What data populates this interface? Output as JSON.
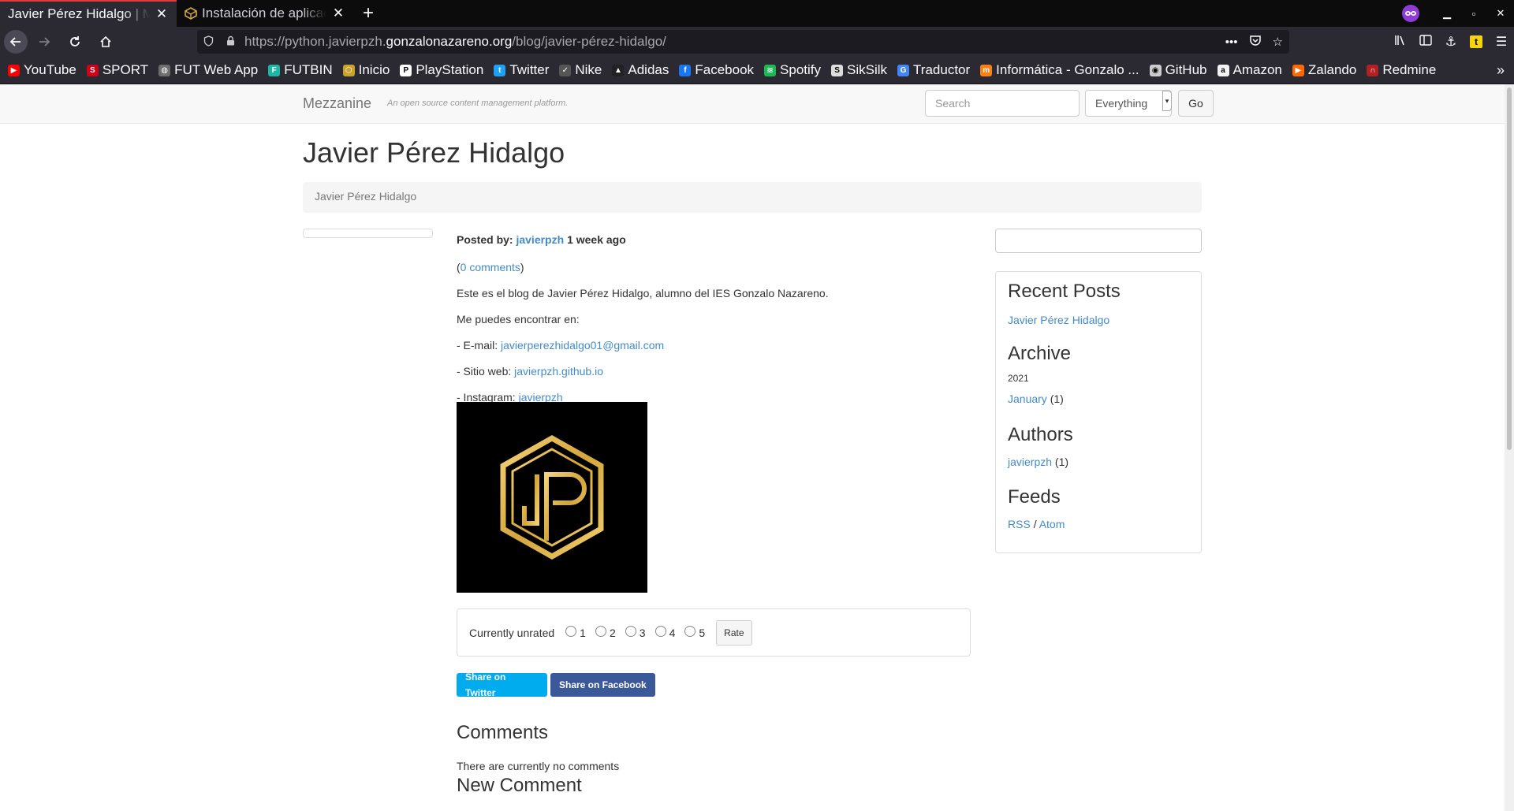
{
  "browser": {
    "tabs": [
      {
        "title": "Javier Pérez Hidalgo | Mezzanine",
        "active": true
      },
      {
        "title": "Instalación de aplicaciones web python",
        "active": false
      }
    ],
    "url": {
      "prefix": "https://python.javierpzh.",
      "host": "gonzalonazareno.org",
      "path": "/blog/javier-pérez-hidalgo/"
    },
    "bookmarks": [
      {
        "label": "YouTube",
        "icon": "youtube-icon",
        "color": "#ff0000"
      },
      {
        "label": "SPORT",
        "icon": "sport-icon",
        "color": "#d0021b"
      },
      {
        "label": "FUT Web App",
        "icon": "globe-icon",
        "color": "#6d6d6d"
      },
      {
        "label": "FUTBIN",
        "icon": "futbin-icon",
        "color": "#1db6a5"
      },
      {
        "label": "Inicio",
        "icon": "cube-icon",
        "color": "#c9a227"
      },
      {
        "label": "PlayStation",
        "icon": "playstation-icon",
        "color": "#ffffff"
      },
      {
        "label": "Twitter",
        "icon": "twitter-icon",
        "color": "#1da1f2"
      },
      {
        "label": "Nike",
        "icon": "nike-icon",
        "color": "#555555"
      },
      {
        "label": "Adidas",
        "icon": "adidas-icon",
        "color": "#222222"
      },
      {
        "label": "Facebook",
        "icon": "facebook-icon",
        "color": "#1877f2"
      },
      {
        "label": "Spotify",
        "icon": "spotify-icon",
        "color": "#1db954"
      },
      {
        "label": "SikSilk",
        "icon": "siksilk-icon",
        "color": "#dddddd"
      },
      {
        "label": "Traductor",
        "icon": "translate-icon",
        "color": "#4285f4"
      },
      {
        "label": "Informática - Gonzalo ...",
        "icon": "moodle-icon",
        "color": "#f98012"
      },
      {
        "label": "GitHub",
        "icon": "github-icon",
        "color": "#cccccc"
      },
      {
        "label": "Amazon",
        "icon": "amazon-icon",
        "color": "#f4f4f4"
      },
      {
        "label": "Zalando",
        "icon": "zalando-icon",
        "color": "#ff6900"
      },
      {
        "label": "Redmine",
        "icon": "redmine-icon",
        "color": "#b32024"
      }
    ]
  },
  "site": {
    "brand": "Mezzanine",
    "tagline": "An open source content management platform.",
    "search": {
      "placeholder": "Search",
      "select_value": "Everything",
      "go_label": "Go"
    }
  },
  "post": {
    "title": "Javier Pérez Hidalgo",
    "breadcrumb": "Javier Pérez Hidalgo",
    "posted_by_label": "Posted by:",
    "author": "javierpzh",
    "time_ago": "1 week ago",
    "comments_link": "0 comments",
    "intro": "Este es el blog de Javier Pérez Hidalgo, alumno del IES Gonzalo Nazareno.",
    "find_me": "Me puedes encontrar en:",
    "email_label": "- E-mail:",
    "email": "javierperezhidalgo01@gmail.com",
    "web_label": "- Sitio web:",
    "web": "javierpzh.github.io",
    "instagram_label": "- Instagram:",
    "instagram": "javierpzh",
    "rating": {
      "label": "Currently unrated",
      "options": [
        "1",
        "2",
        "3",
        "4",
        "5"
      ],
      "button": "Rate"
    },
    "share_twitter": "Share on Twitter",
    "share_facebook": "Share on Facebook",
    "comments_heading": "Comments",
    "no_comments": "There are currently no comments",
    "new_comment_heading": "New Comment"
  },
  "sidebar": {
    "recent_heading": "Recent Posts",
    "recent_item": "Javier Pérez Hidalgo",
    "archive_heading": "Archive",
    "archive_year": "2021",
    "archive_month": "January",
    "archive_count": "(1)",
    "authors_heading": "Authors",
    "author_name": "javierpzh",
    "author_count": "(1)",
    "feeds_heading": "Feeds",
    "rss": "RSS",
    "separator": "/",
    "atom": "Atom"
  }
}
